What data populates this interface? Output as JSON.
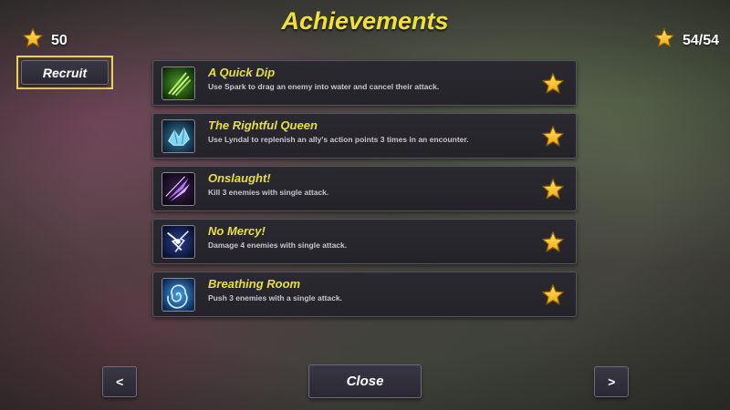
{
  "header": {
    "title": "Achievements"
  },
  "currency": {
    "stars_left": "50",
    "stars_right": "54/54"
  },
  "buttons": {
    "recruit": "Recruit",
    "close": "Close",
    "prev": "<",
    "next": ">"
  },
  "colors": {
    "title": "#f2e03a",
    "row_title": "#e6e03a",
    "highlight_border": "#e7d54a",
    "star": "#f5c518"
  },
  "achievements": [
    {
      "title": "A Quick Dip",
      "description": "Use Spark to drag an enemy into water and cancel their attack.",
      "icon": "green-claw-slash-icon",
      "completed": true
    },
    {
      "title": "The Rightful Queen",
      "description": "Use Lyndal to replenish an ally's action points 3 times in an encounter.",
      "icon": "blue-crystal-icon",
      "completed": true
    },
    {
      "title": "Onslaught!",
      "description": "Kill 3 enemies with single attack.",
      "icon": "purple-strike-icon",
      "completed": true
    },
    {
      "title": "No Mercy!",
      "description": "Damage 4 enemies with single attack.",
      "icon": "lightning-burst-icon",
      "completed": true
    },
    {
      "title": "Breathing Room",
      "description": "Push 3 enemies with a single attack.",
      "icon": "blue-vortex-icon",
      "completed": true
    }
  ]
}
